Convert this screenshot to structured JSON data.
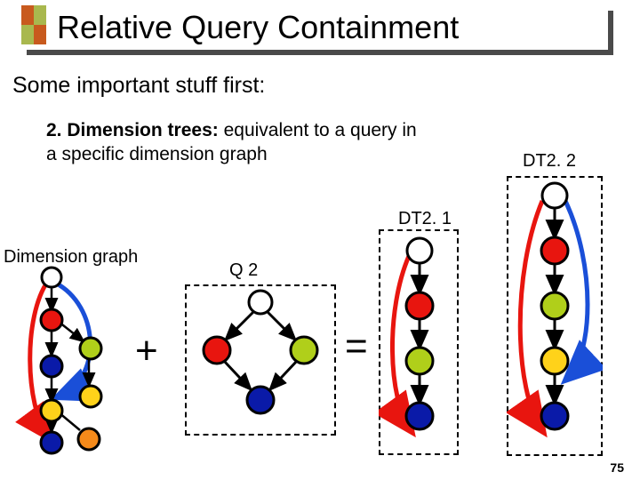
{
  "title": "Relative Query Containment",
  "subtitle": "Some important stuff first:",
  "item_number": "2.",
  "item_title": "Dimension trees:",
  "item_rest": " equivalent to a query in a specific dimension graph",
  "labels": {
    "dt22": "DT2. 2",
    "dt21": "DT2. 1",
    "dimgraph": "Dimension graph",
    "q2": "Q 2"
  },
  "ops": {
    "plus": "+",
    "eq": "="
  },
  "page": "75",
  "colors": {
    "red": "#e8150f",
    "green": "#b0cf1a",
    "blue": "#0a1aa8",
    "yellow": "#ffd21a",
    "orange": "#f58a1a",
    "white": "#ffffff",
    "black": "#000000",
    "curveRed": "#e8150f",
    "curveBlue": "#1a4fd8"
  }
}
